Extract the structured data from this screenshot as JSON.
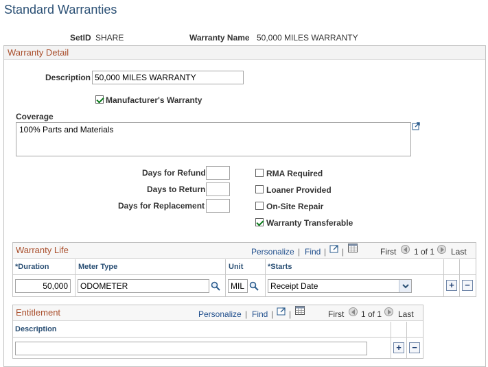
{
  "page": {
    "title": "Standard Warranties"
  },
  "header": {
    "setid_label": "SetID",
    "setid_value": "SHARE",
    "warranty_name_label": "Warranty Name",
    "warranty_name_value": "50,000 MILES WARRANTY"
  },
  "detail": {
    "section_title": "Warranty Detail",
    "description_label": "Description",
    "description_value": "50,000 MILES WARRANTY",
    "manufacturer_label": "Manufacturer's Warranty",
    "manufacturer_checked": true,
    "coverage_label": "Coverage",
    "coverage_value": "100% Parts and Materials",
    "days_refund_label": "Days for Refund",
    "days_refund_value": "",
    "days_return_label": "Days to Return",
    "days_return_value": "",
    "days_replacement_label": "Days for Replacement",
    "days_replacement_value": "",
    "rma_label": "RMA Required",
    "rma_checked": false,
    "loaner_label": "Loaner Provided",
    "loaner_checked": false,
    "onsite_label": "On-Site Repair",
    "onsite_checked": false,
    "transferable_label": "Warranty Transferable",
    "transferable_checked": true
  },
  "warranty_life": {
    "title": "Warranty Life",
    "personalize": "Personalize",
    "find": "Find",
    "first": "First",
    "range": "1 of 1",
    "last": "Last",
    "columns": {
      "duration": "*Duration",
      "meter_type": "Meter Type",
      "unit": "Unit",
      "starts": "*Starts"
    },
    "row": {
      "duration": "50,000",
      "meter_type": "ODOMETER",
      "unit": "MIL",
      "starts": "Receipt Date"
    },
    "add_symbol": "+",
    "delete_symbol": "−"
  },
  "entitlement": {
    "title": "Entitlement",
    "personalize": "Personalize",
    "find": "Find",
    "first": "First",
    "range": "1 of 1",
    "last": "Last",
    "columns": {
      "description": "Description"
    },
    "row": {
      "description": ""
    },
    "add_symbol": "+",
    "delete_symbol": "−"
  },
  "icons": {
    "expand": "expand-textarea-icon",
    "lookup": "magnifier-icon",
    "view_all": "view-all-icon",
    "spreadsheet": "spreadsheet-icon",
    "prev": "previous-arrow-icon",
    "next": "next-arrow-icon",
    "dropdown": "chevron-down-icon"
  },
  "colors": {
    "section_title": "#a94e2b",
    "link": "#1f4e8c",
    "page_title": "#2a4f74"
  }
}
